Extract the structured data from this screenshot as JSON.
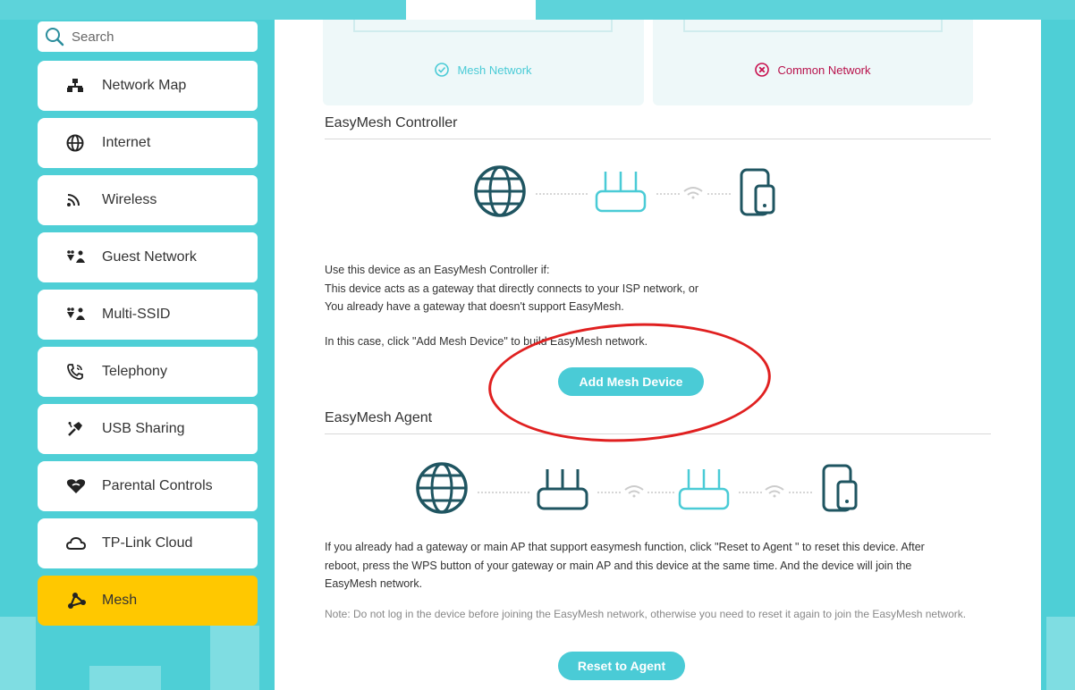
{
  "search": {
    "placeholder": "Search"
  },
  "sidebar": {
    "items": [
      {
        "label": "Network Map",
        "icon": "network-map-icon"
      },
      {
        "label": "Internet",
        "icon": "globe-icon"
      },
      {
        "label": "Wireless",
        "icon": "wireless-icon"
      },
      {
        "label": "Guest Network",
        "icon": "guest-network-icon"
      },
      {
        "label": "Multi-SSID",
        "icon": "multi-ssid-icon"
      },
      {
        "label": "Telephony",
        "icon": "telephony-icon"
      },
      {
        "label": "USB Sharing",
        "icon": "usb-icon"
      },
      {
        "label": "Parental Controls",
        "icon": "parental-controls-icon"
      },
      {
        "label": "TP-Link Cloud",
        "icon": "cloud-icon"
      },
      {
        "label": "Mesh",
        "icon": "mesh-icon"
      }
    ],
    "active_index": 9
  },
  "network_types": {
    "mesh": "Mesh Network",
    "common": "Common Network"
  },
  "controller": {
    "title": "EasyMesh Controller",
    "intro": "Use this device as an EasyMesh Controller if:",
    "line1": "This device acts as a gateway that directly connects to your ISP network, or",
    "line2": "You already have a gateway that doesn't support EasyMesh.",
    "instruction": "In this case, click \"Add Mesh Device\" to build EasyMesh network.",
    "button": "Add Mesh Device"
  },
  "agent": {
    "title": "EasyMesh Agent",
    "description1": "If you already had a gateway or main AP that support easymesh function, click \"Reset to Agent \" to reset this device. After",
    "description2": "reboot, press the WPS button of your gateway or main AP and this device at the same time. And the device will join the",
    "description3": "EasyMesh network.",
    "note": "Note: Do not log in the device before joining the EasyMesh network, otherwise you need to reset it again to join the EasyMesh network.",
    "button": "Reset to Agent"
  },
  "colors": {
    "accent": "#4acbd6",
    "active": "#ffc800",
    "background": "#4ecfd6",
    "icon_dark": "#1f5561",
    "annotation": "#e02020"
  }
}
